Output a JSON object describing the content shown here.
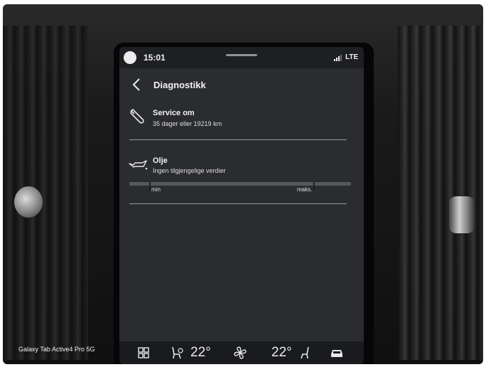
{
  "status_bar": {
    "time": "15:01",
    "network": "LTE"
  },
  "header": {
    "title": "Diagnostikk",
    "back_icon": "chevron-left-icon"
  },
  "service": {
    "icon": "wrench-icon",
    "title": "Service om",
    "detail": "35 dager eller 19219 km"
  },
  "oil": {
    "icon": "oil-can-icon",
    "title": "Olje",
    "detail": "Ingen tilgjengelige verdier",
    "gauge_min_label": "min",
    "gauge_max_label": "maks."
  },
  "climate_bar": {
    "home_icon": "grid-icon",
    "seat_left_icon": "heated-seat-icon",
    "left_temp": "22°",
    "fan_icon": "fan-icon",
    "right_temp": "22°",
    "seat_right_icon": "seat-icon",
    "car_icon": "car-icon"
  },
  "photo_watermark": "Galaxy Tab Active4 Pro 5G",
  "colors": {
    "screen_bg": "#2b2c2f",
    "status_bar_bg": "#1e1f22",
    "text": "#e9e9e9",
    "divider": "#9a9b9f"
  }
}
